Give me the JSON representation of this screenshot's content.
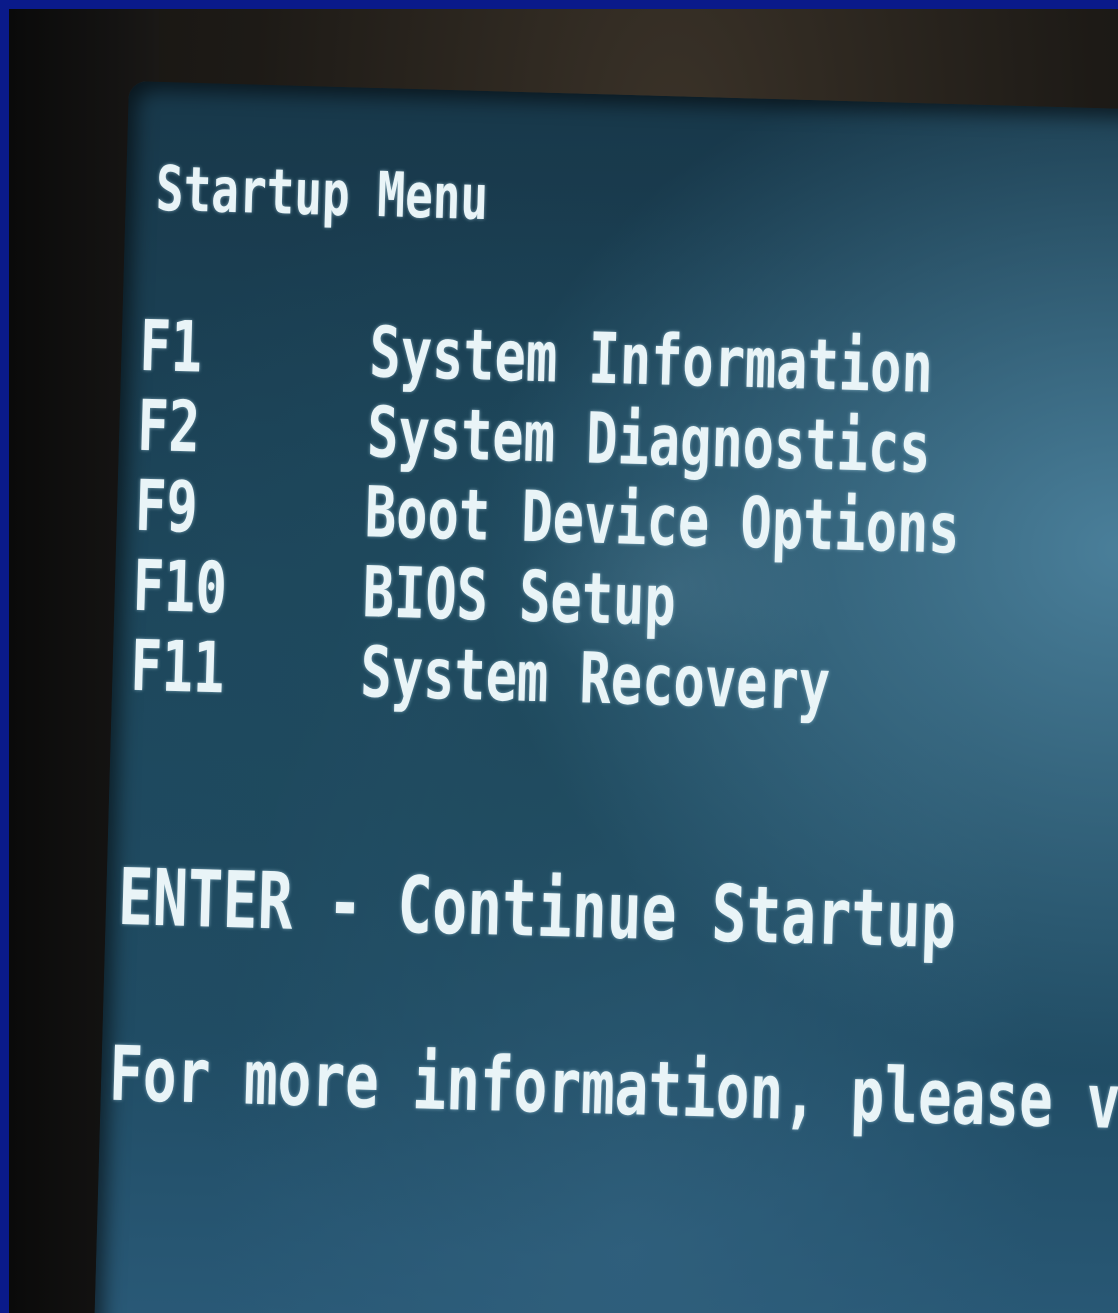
{
  "menu": {
    "title": "Startup Menu",
    "items": [
      {
        "key": "F1",
        "label": "System Information"
      },
      {
        "key": "F2",
        "label": "System Diagnostics"
      },
      {
        "key": "F9",
        "label": "Boot Device Options"
      },
      {
        "key": "F10",
        "label": "BIOS Setup"
      },
      {
        "key": "F11",
        "label": "System Recovery"
      }
    ],
    "enter_line": "ENTER - Continue Startup",
    "info_line": "For more information, please visi"
  },
  "colors": {
    "screen": "#1d465b",
    "text": "#e9f4f7",
    "border": "#0a1a8a"
  }
}
